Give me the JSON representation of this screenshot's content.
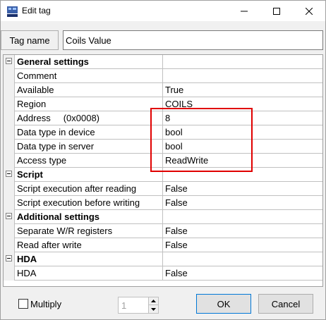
{
  "window": {
    "title": "Edit tag",
    "icon": "opc-tag-icon",
    "controls": [
      "minimize-icon",
      "maximize-icon",
      "close-icon"
    ]
  },
  "tag": {
    "label": "Tag name",
    "value": "Coils Value"
  },
  "properties": [
    {
      "type": "category",
      "name": "General settings"
    },
    {
      "type": "prop",
      "name": "Comment",
      "value": ""
    },
    {
      "type": "prop",
      "name": "Available",
      "value": "True"
    },
    {
      "type": "prop",
      "name": "Region",
      "value": "COILS"
    },
    {
      "type": "prop",
      "name": "Address",
      "hex": "(0x0008)",
      "value": "8"
    },
    {
      "type": "prop",
      "name": "Data type in device",
      "value": "bool"
    },
    {
      "type": "prop",
      "name": "Data type in server",
      "value": "bool"
    },
    {
      "type": "prop",
      "name": "Access type",
      "value": "ReadWrite"
    },
    {
      "type": "category",
      "name": "Script"
    },
    {
      "type": "prop",
      "name": "Script execution after reading",
      "value": "False"
    },
    {
      "type": "prop",
      "name": "Script execution before writing",
      "value": "False"
    },
    {
      "type": "category",
      "name": "Additional settings"
    },
    {
      "type": "prop",
      "name": "Separate W/R registers",
      "value": "False"
    },
    {
      "type": "prop",
      "name": "Read after write",
      "value": "False"
    },
    {
      "type": "category",
      "name": "HDA"
    },
    {
      "type": "prop",
      "name": "HDA",
      "value": "False"
    }
  ],
  "footer": {
    "multiply_label": "Multiply",
    "multiply_checked": false,
    "spin_value": "1",
    "ok_label": "OK",
    "cancel_label": "Cancel"
  },
  "colors": {
    "highlight": "#e00000",
    "accent": "#0078d7"
  }
}
